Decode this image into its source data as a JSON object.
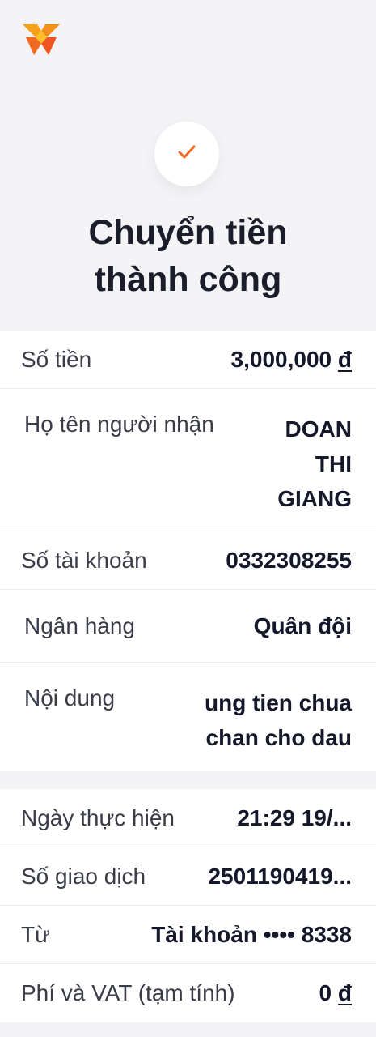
{
  "header": {
    "logo_icon": "brand-logo-icon",
    "status_icon": "checkmark-icon",
    "title_line1": "Chuyển tiền",
    "title_line2": "thành công"
  },
  "details": {
    "amount_label": "Số tiền",
    "amount_value": "3,000,000 ",
    "amount_currency": "đ",
    "recipient_label": "Họ tên người nhận",
    "recipient_value": "DOAN THI GIANG",
    "account_label": "Số tài khoản",
    "account_value": "0332308255",
    "bank_label": "Ngân hàng",
    "bank_value": "Quân đội",
    "content_label": "Nội dung",
    "content_value": "ung tien chua chan cho dau"
  },
  "transaction": {
    "date_label": "Ngày thực hiện",
    "date_value": "21:29 19/...",
    "txn_label": "Số giao dịch",
    "txn_value": "2501190419...",
    "from_label": "Từ",
    "from_value": "Tài khoản •••• 8338",
    "fee_label": "Phí và VAT (tạm tính)",
    "fee_value": "0 ",
    "fee_currency": "đ"
  },
  "colors": {
    "background": "#f4f4f6",
    "accent": "#f7931e",
    "text": "#15172a"
  }
}
